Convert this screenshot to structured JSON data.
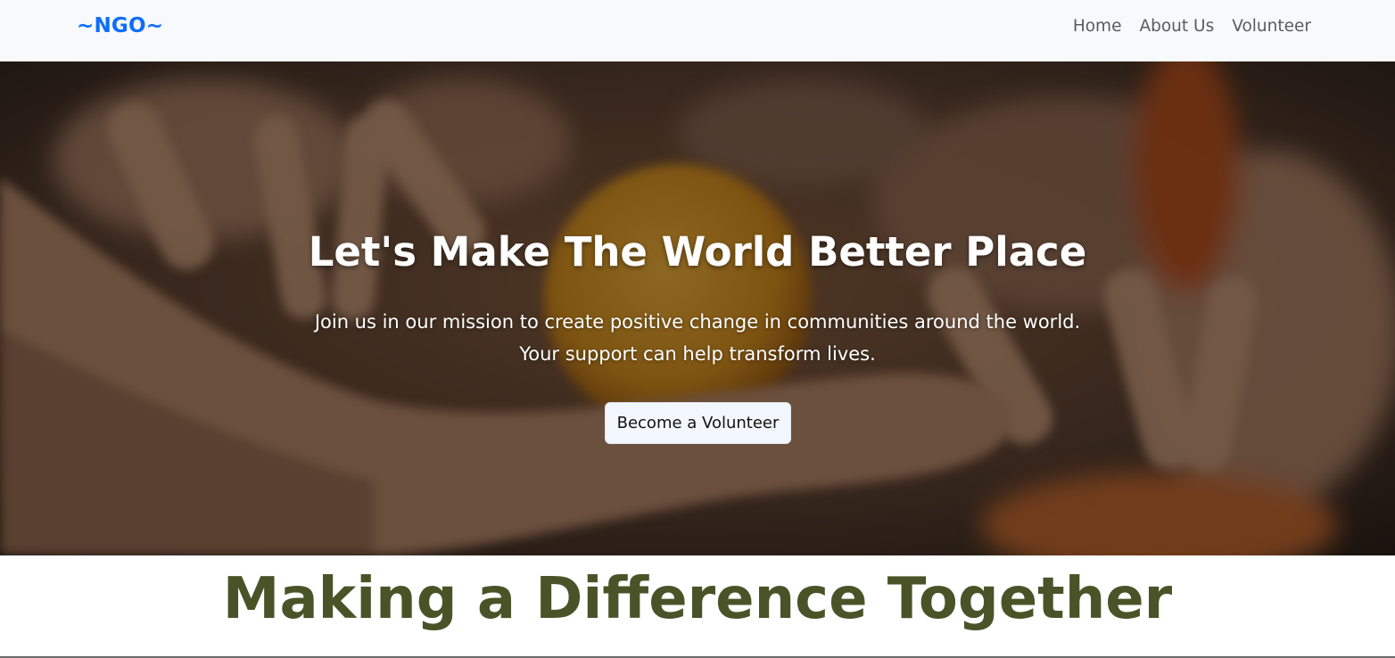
{
  "navbar": {
    "brand": "~NGO~",
    "links": [
      {
        "label": "Home"
      },
      {
        "label": "About Us"
      },
      {
        "label": "Volunteer"
      }
    ],
    "brand_color": "#0d6efd",
    "background": "#f8f9fa"
  },
  "hero": {
    "title": "Let's Make The World Better Place",
    "subtitle_line1": "Join us in our mission to create positive change in communities around the world.",
    "subtitle_line2": "Your support can help transform lives.",
    "button_label": "Become a Volunteer",
    "background_image_icon": "hands-reaching-for-orange-photo"
  },
  "section": {
    "heading": "Making a Difference Together",
    "heading_color": "#4a5328"
  }
}
